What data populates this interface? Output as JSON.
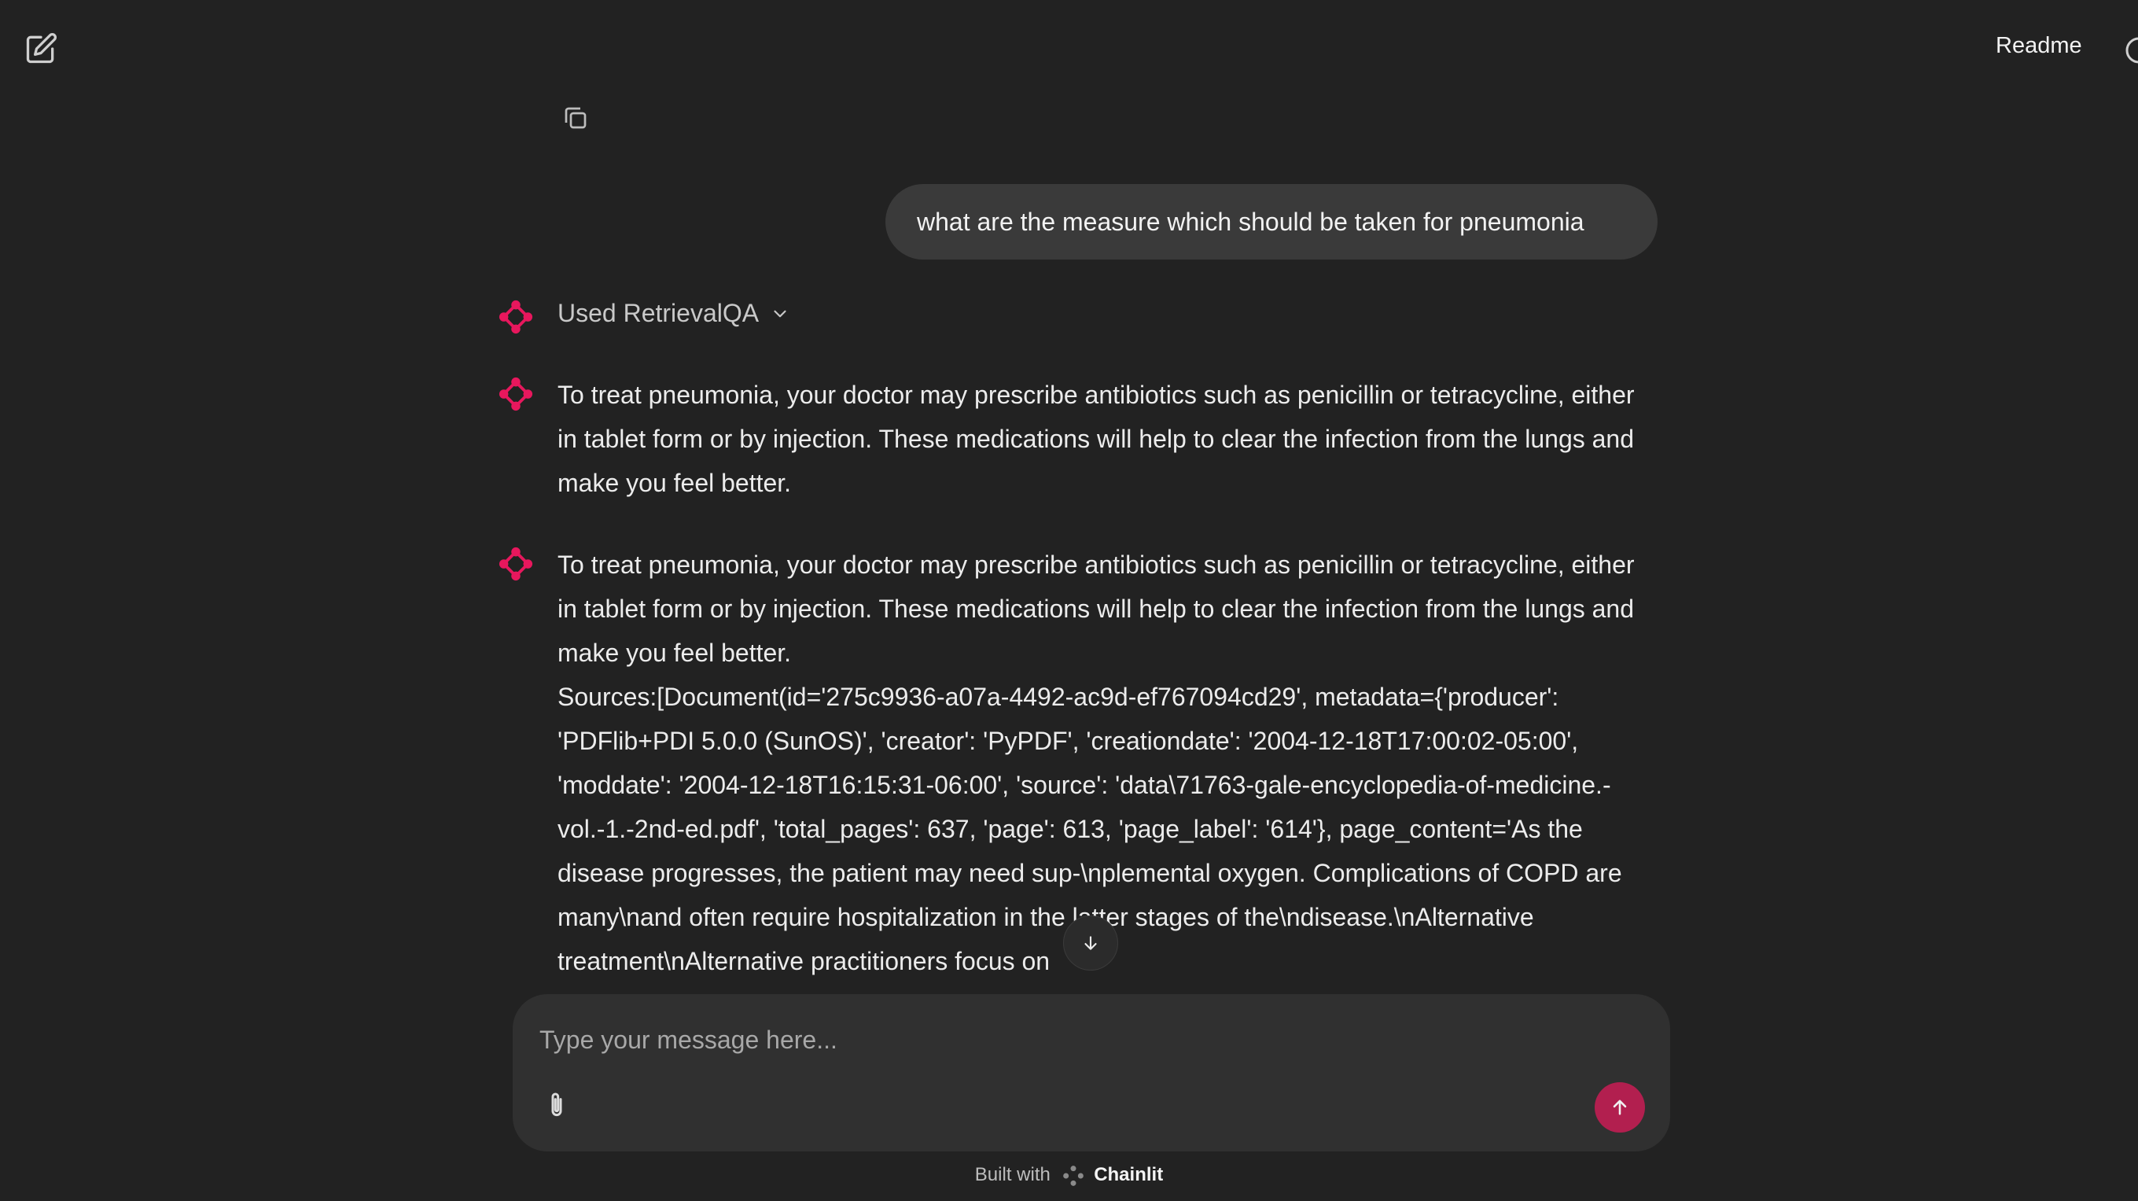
{
  "header": {
    "readme_label": "Readme"
  },
  "composer": {
    "placeholder": "Type your message here..."
  },
  "conversation": {
    "user_message": "what are the measure which should be taken for pneumonia",
    "step_label": "Used RetrievalQA",
    "assistant_messages": [
      "To treat pneumonia, your doctor may prescribe antibiotics such as penicillin or tetracycline, either in tablet form or by injection. These medications will help to clear the infection from the lungs and make you feel better.",
      "To treat pneumonia, your doctor may prescribe antibiotics such as penicillin or tetracycline, either in tablet form or by injection. These medications will help to clear the infection from the lungs and make you feel better.\nSources:[Document(id='275c9936-a07a-4492-ac9d-ef767094cd29', metadata={'producer': 'PDFlib+PDI 5.0.0 (SunOS)', 'creator': 'PyPDF', 'creationdate': '2004-12-18T17:00:02-05:00', 'moddate': '2004-12-18T16:15:31-06:00', 'source': 'data\\71763-gale-encyclopedia-of-medicine.-vol.-1.-2nd-ed.pdf', 'total_pages': 637, 'page': 613, 'page_label': '614'}, page_content='As the disease progresses, the patient may need sup-\\nplemental oxygen. Complications of COPD are many\\nand often require hospitalization in the latter stages of the\\ndisease.\\nAlternative treatment\\nAlternative practitioners focus on"
    ]
  },
  "footer": {
    "prefix": "Built with",
    "brand": "Chainlit"
  },
  "colors": {
    "accent": "#e8175d",
    "send_button": "#b21f4f",
    "background": "#222222"
  },
  "icons": [
    "edit-icon",
    "copy-icon",
    "theme-toggle-icon",
    "chevron-down-icon",
    "arrow-down-icon",
    "paperclip-icon",
    "arrow-up-icon",
    "chainlit-logo-icon"
  ]
}
